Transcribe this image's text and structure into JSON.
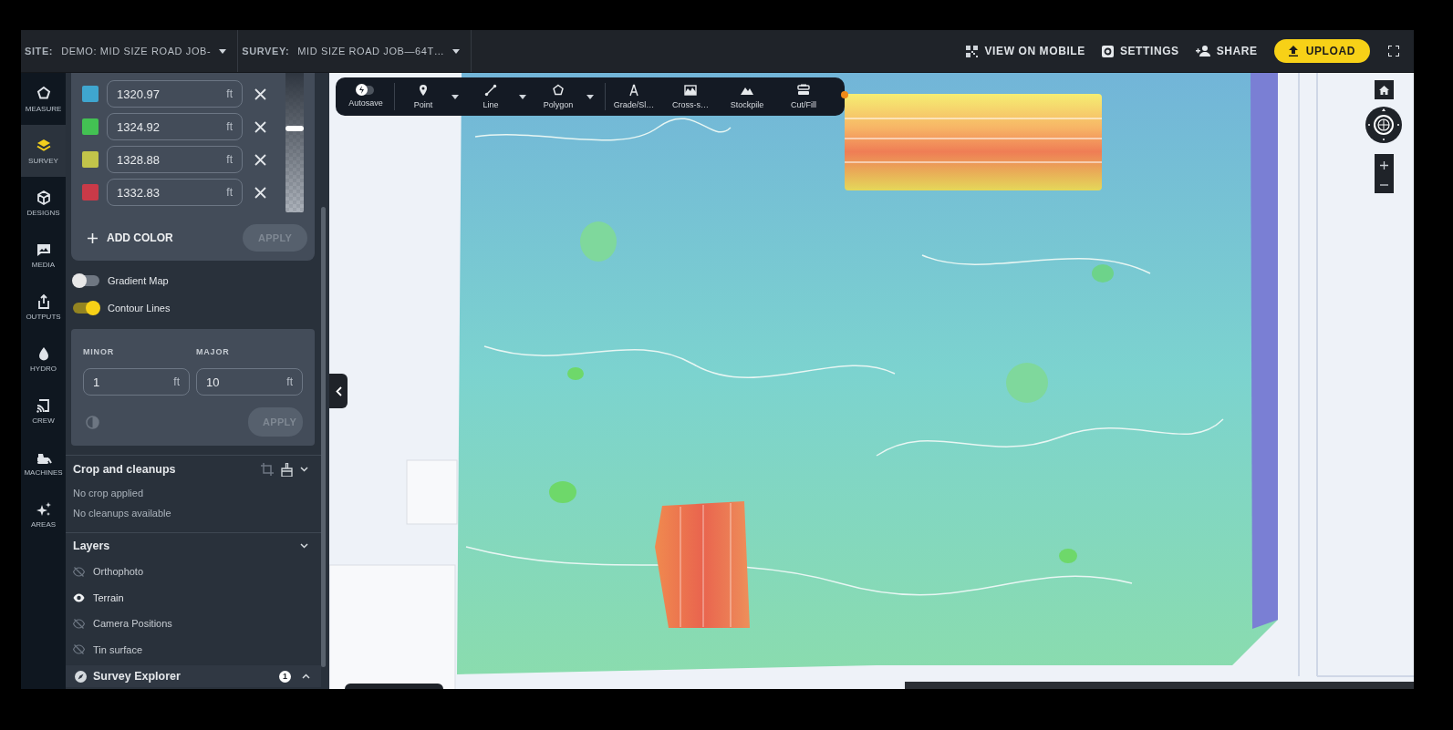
{
  "site": {
    "label": "SITE:",
    "value": "DEMO: MID SIZE ROAD JOB-"
  },
  "survey": {
    "label": "SURVEY:",
    "value": "MID SIZE ROAD JOB—64T…"
  },
  "header_actions": [
    {
      "label": "VIEW ON MOBILE"
    },
    {
      "label": "SETTINGS"
    },
    {
      "label": "SHARE"
    }
  ],
  "upload_button": "UPLOAD",
  "nav": [
    {
      "label": "MEASURE",
      "selected": false
    },
    {
      "label": "SURVEY",
      "selected": true
    },
    {
      "label": "DESIGNS",
      "selected": false
    },
    {
      "label": "MEDIA",
      "selected": false
    },
    {
      "label": "OUTPUTS",
      "selected": false
    },
    {
      "label": "HYDRO",
      "selected": false
    },
    {
      "label": "CREW",
      "selected": false
    },
    {
      "label": "MACHINES",
      "selected": false
    },
    {
      "label": "AREAS",
      "selected": false
    }
  ],
  "color_stops": [
    {
      "color": "#3fa6cf",
      "value": "1320.97",
      "unit": "ft"
    },
    {
      "color": "#43c153",
      "value": "1324.92",
      "unit": "ft"
    },
    {
      "color": "#c2c44a",
      "value": "1328.88",
      "unit": "ft"
    },
    {
      "color": "#c93a48",
      "value": "1332.83",
      "unit": "ft"
    }
  ],
  "opacity_slider": {
    "level": 0.6
  },
  "add_color": "ADD COLOR",
  "color_apply": {
    "label": "APPLY",
    "disabled": true
  },
  "toggles": [
    {
      "label": "Gradient Map",
      "on": false
    },
    {
      "label": "Contour Lines",
      "on": true
    }
  ],
  "contour": {
    "fields": [
      {
        "label": "MINOR",
        "value": "1",
        "unit": "ft"
      },
      {
        "label": "MAJOR",
        "value": "10",
        "unit": "ft"
      }
    ],
    "apply": {
      "label": "APPLY",
      "disabled": true
    }
  },
  "crop": {
    "title": "Crop and cleanups",
    "lines": [
      "No crop applied",
      "No cleanups available"
    ]
  },
  "layers": {
    "title": "Layers",
    "items": [
      {
        "label": "Orthophoto",
        "visible": false
      },
      {
        "label": "Terrain",
        "visible": true
      },
      {
        "label": "Camera Positions",
        "visible": false
      },
      {
        "label": "Tin surface",
        "visible": false
      }
    ]
  },
  "survey_explorer": {
    "title": "Survey Explorer",
    "badge": "1"
  },
  "toolbar": {
    "autosave": {
      "label": "Autosave",
      "on": false
    },
    "tools": [
      {
        "label": "Point",
        "dropdown": true
      },
      {
        "label": "Line",
        "dropdown": true
      },
      {
        "label": "Polygon",
        "dropdown": true
      },
      {
        "label": "Grade/Sl…",
        "dropdown": false
      },
      {
        "label": "Cross-s…",
        "dropdown": false
      },
      {
        "label": "Stockpile",
        "dropdown": false
      },
      {
        "label": "Cut/Fill",
        "dropdown": false
      }
    ]
  }
}
